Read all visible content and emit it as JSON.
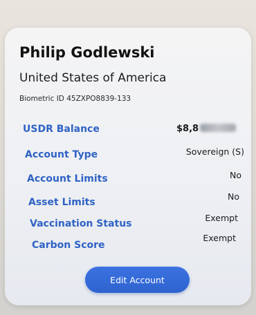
{
  "account": {
    "name": "Philip Godlewski",
    "country": "United States of America",
    "biometric_id": "Biometric ID 45ZXPO8839-133"
  },
  "rows": [
    {
      "label": "USDR Balance",
      "value": "$8,8"
    },
    {
      "label": "Account Type",
      "value": "Sovereign (S)"
    },
    {
      "label": "Account Limits",
      "value": "No"
    },
    {
      "label": "Asset Limits",
      "value": "No"
    },
    {
      "label": "Vaccination Status",
      "value": "Exempt"
    },
    {
      "label": "Carbon Score",
      "value": "Exempt"
    }
  ],
  "actions": {
    "edit_label": "Edit Account"
  },
  "colors": {
    "label_blue": "#2f62c4",
    "button_blue": "#3268d6"
  }
}
